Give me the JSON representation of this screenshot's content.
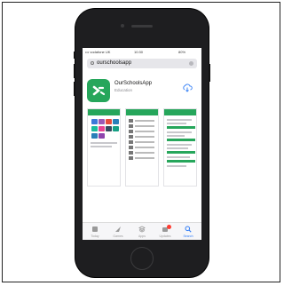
{
  "status_bar": {
    "carrier": "••• vodafone UK",
    "time": "10:30",
    "battery": "80%"
  },
  "search": {
    "query": "ourschoolsapp"
  },
  "app": {
    "name": "OurSchoolsApp",
    "category": "Education"
  },
  "tabs": [
    {
      "label": "Today",
      "icon": "today-icon"
    },
    {
      "label": "Games",
      "icon": "games-icon"
    },
    {
      "label": "Apps",
      "icon": "apps-icon"
    },
    {
      "label": "Updates",
      "icon": "updates-icon"
    },
    {
      "label": "Search",
      "icon": "search-icon",
      "active": true
    }
  ],
  "colors": {
    "brand": "#26a65b",
    "active_tab": "#2f7cf6",
    "badge": "#ff3b30",
    "device": "#1e1e20"
  }
}
